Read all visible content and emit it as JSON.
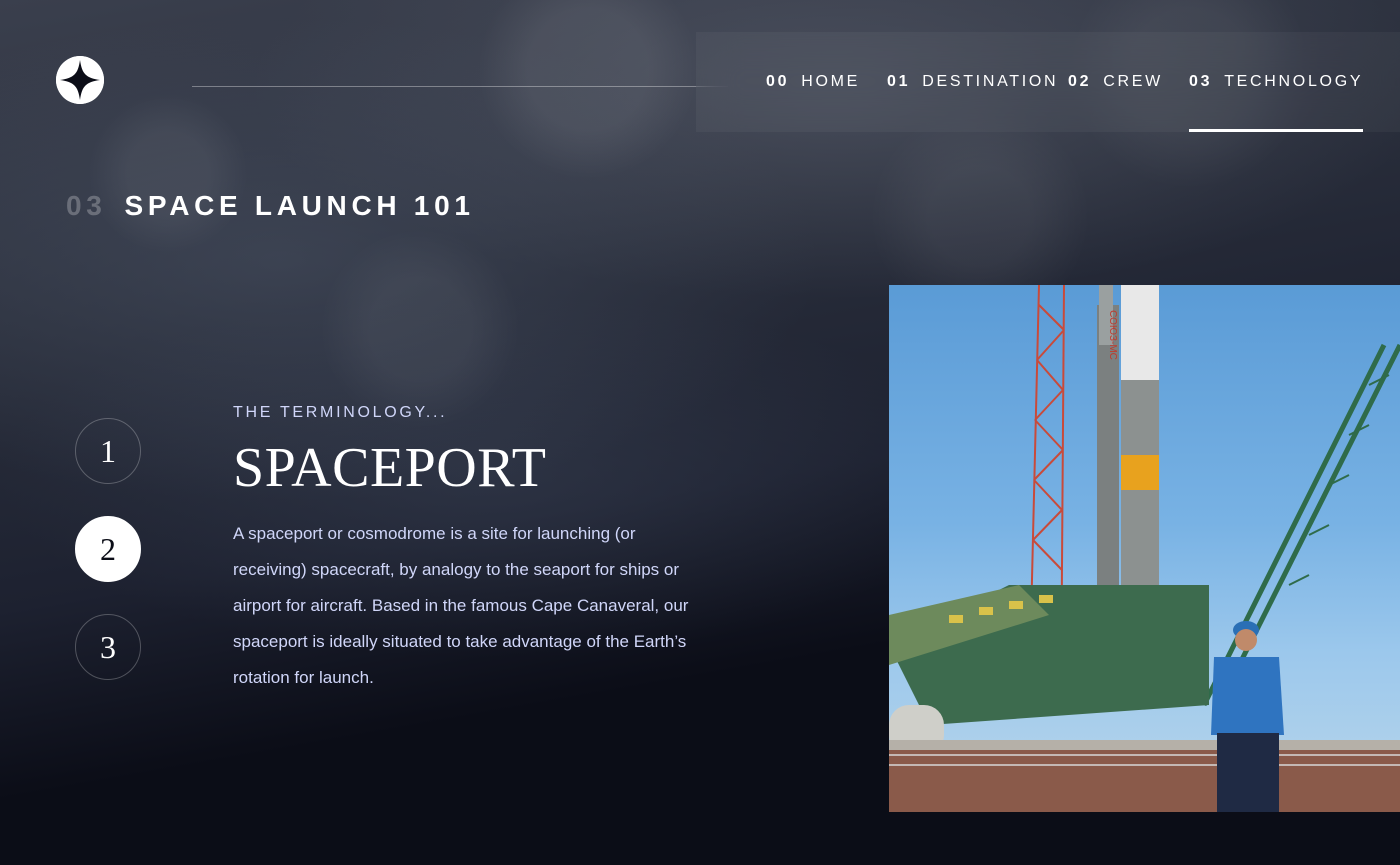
{
  "nav": {
    "items": [
      {
        "num": "00",
        "label": "HOME"
      },
      {
        "num": "01",
        "label": "DESTINATION"
      },
      {
        "num": "02",
        "label": "CREW"
      },
      {
        "num": "03",
        "label": "TECHNOLOGY"
      }
    ],
    "active_index": 3
  },
  "page": {
    "section_num": "03",
    "section_title": "SPACE LAUNCH 101"
  },
  "steps": [
    "1",
    "2",
    "3"
  ],
  "active_step": 2,
  "technology": {
    "eyebrow": "THE TERMINOLOGY...",
    "name": "SPACEPORT",
    "description": "A spaceport or cosmodrome is a site for launching (or receiving) spacecraft, by analogy to the seaport for ships or airport for aircraft. Based in the famous Cape Canaveral, our spaceport is ideally situated to take advantage of the Earth’s rotation for launch."
  },
  "photo": {
    "rocket_label": "СОЮЗ-МС"
  },
  "colors": {
    "background": "#0b0d17",
    "accent_light": "#d0d6f9",
    "white": "#ffffff"
  },
  "icons": {
    "logo": "four-point-star-logo-icon"
  }
}
